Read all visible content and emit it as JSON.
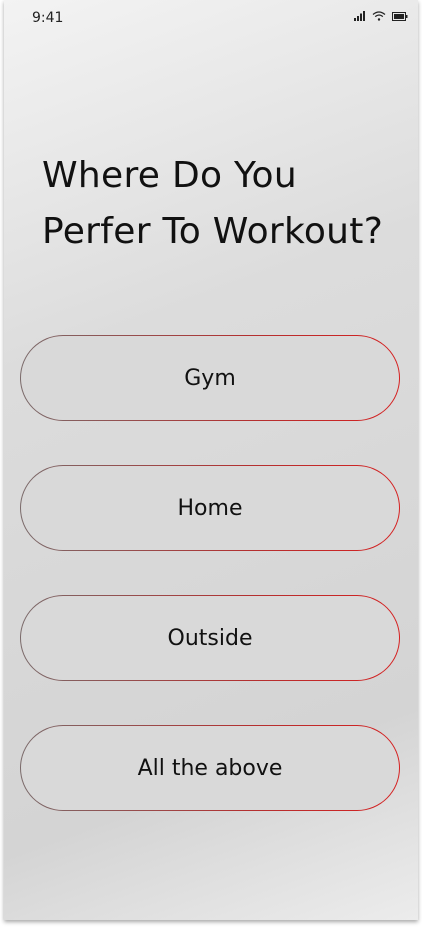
{
  "status_bar": {
    "time": "9:41",
    "icons": [
      "signal-icon",
      "wifi-icon",
      "battery-icon"
    ]
  },
  "question": {
    "line1": "Where Do You",
    "line2": "Perfer To Workout?"
  },
  "options": [
    {
      "label": "Gym"
    },
    {
      "label": "Home"
    },
    {
      "label": "Outside"
    },
    {
      "label": "All the above"
    }
  ],
  "colors": {
    "border_start": "#7a6a6a",
    "border_end": "#d62020",
    "text": "#111111"
  }
}
